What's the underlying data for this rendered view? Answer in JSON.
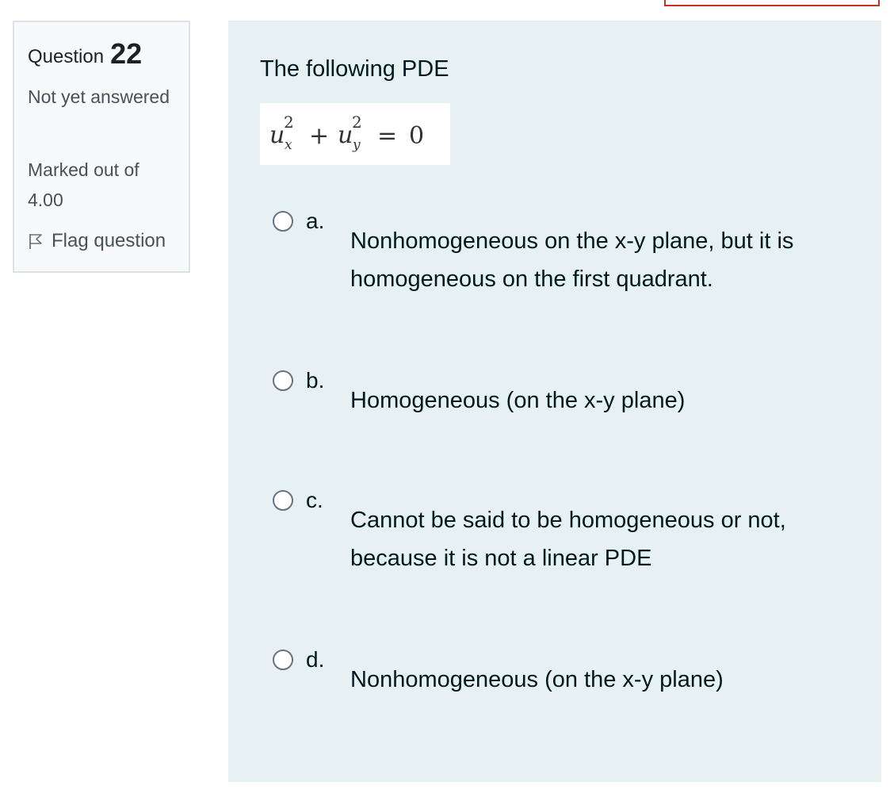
{
  "info": {
    "question_word": "Question",
    "question_number": "22",
    "state": "Not yet answered",
    "grade": "Marked out of 4.00",
    "flag_label": "Flag question",
    "flag_icon": "flag-icon"
  },
  "question": {
    "text": "The following PDE",
    "formula": "u_x^2 + u_y^2 = 0",
    "options": [
      {
        "letter": "a.",
        "text": "Nonhomogeneous on the x-y plane, but it is homogeneous on the first quadrant."
      },
      {
        "letter": "b.",
        "text": "Homogeneous (on the x-y plane)"
      },
      {
        "letter": "c.",
        "text": "Cannot be said to be homogeneous or not, because it is not a linear PDE"
      },
      {
        "letter": "d.",
        "text": "Nonhomogeneous (on the x-y plane)"
      }
    ]
  },
  "colors": {
    "content_background": "#e7f1f4",
    "info_background": "#f8f9fa",
    "accent_outline": "#ca3120"
  }
}
